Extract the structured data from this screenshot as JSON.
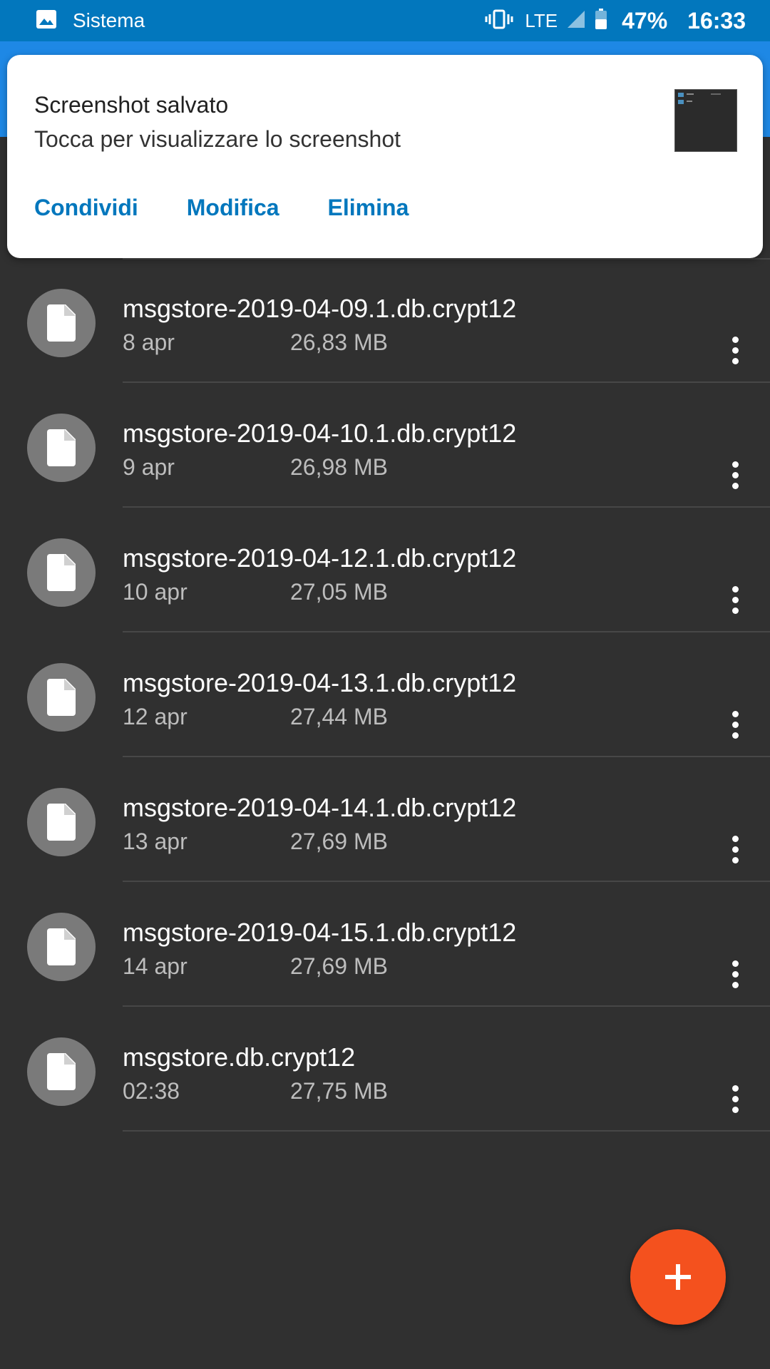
{
  "status_bar": {
    "app_name": "Sistema",
    "network": "LTE",
    "battery": "47%",
    "time": "16:33",
    "icons": [
      "image-icon",
      "vibrate-icon",
      "signal-icon",
      "battery-icon"
    ]
  },
  "notification": {
    "title": "Screenshot salvato",
    "text": "Tocca per visualizzare lo screenshot",
    "actions": [
      "Condividi",
      "Modifica",
      "Elimina"
    ]
  },
  "files": [
    {
      "name": "msgstore-2019-04-09.1.db.crypt12",
      "date": "8 apr",
      "size": "26,83 MB"
    },
    {
      "name": "msgstore-2019-04-10.1.db.crypt12",
      "date": "9 apr",
      "size": "26,98 MB"
    },
    {
      "name": "msgstore-2019-04-12.1.db.crypt12",
      "date": "10 apr",
      "size": "27,05 MB"
    },
    {
      "name": "msgstore-2019-04-13.1.db.crypt12",
      "date": "12 apr",
      "size": "27,44 MB"
    },
    {
      "name": "msgstore-2019-04-14.1.db.crypt12",
      "date": "13 apr",
      "size": "27,69 MB"
    },
    {
      "name": "msgstore-2019-04-15.1.db.crypt12",
      "date": "14 apr",
      "size": "27,69 MB"
    },
    {
      "name": "msgstore.db.crypt12",
      "date": "02:38",
      "size": "27,75 MB"
    }
  ],
  "colors": {
    "status_bar": "#0277bd",
    "app_bar": "#1e88e5",
    "background": "#303030",
    "accent": "#0277bd",
    "fab": "#f4511e"
  }
}
